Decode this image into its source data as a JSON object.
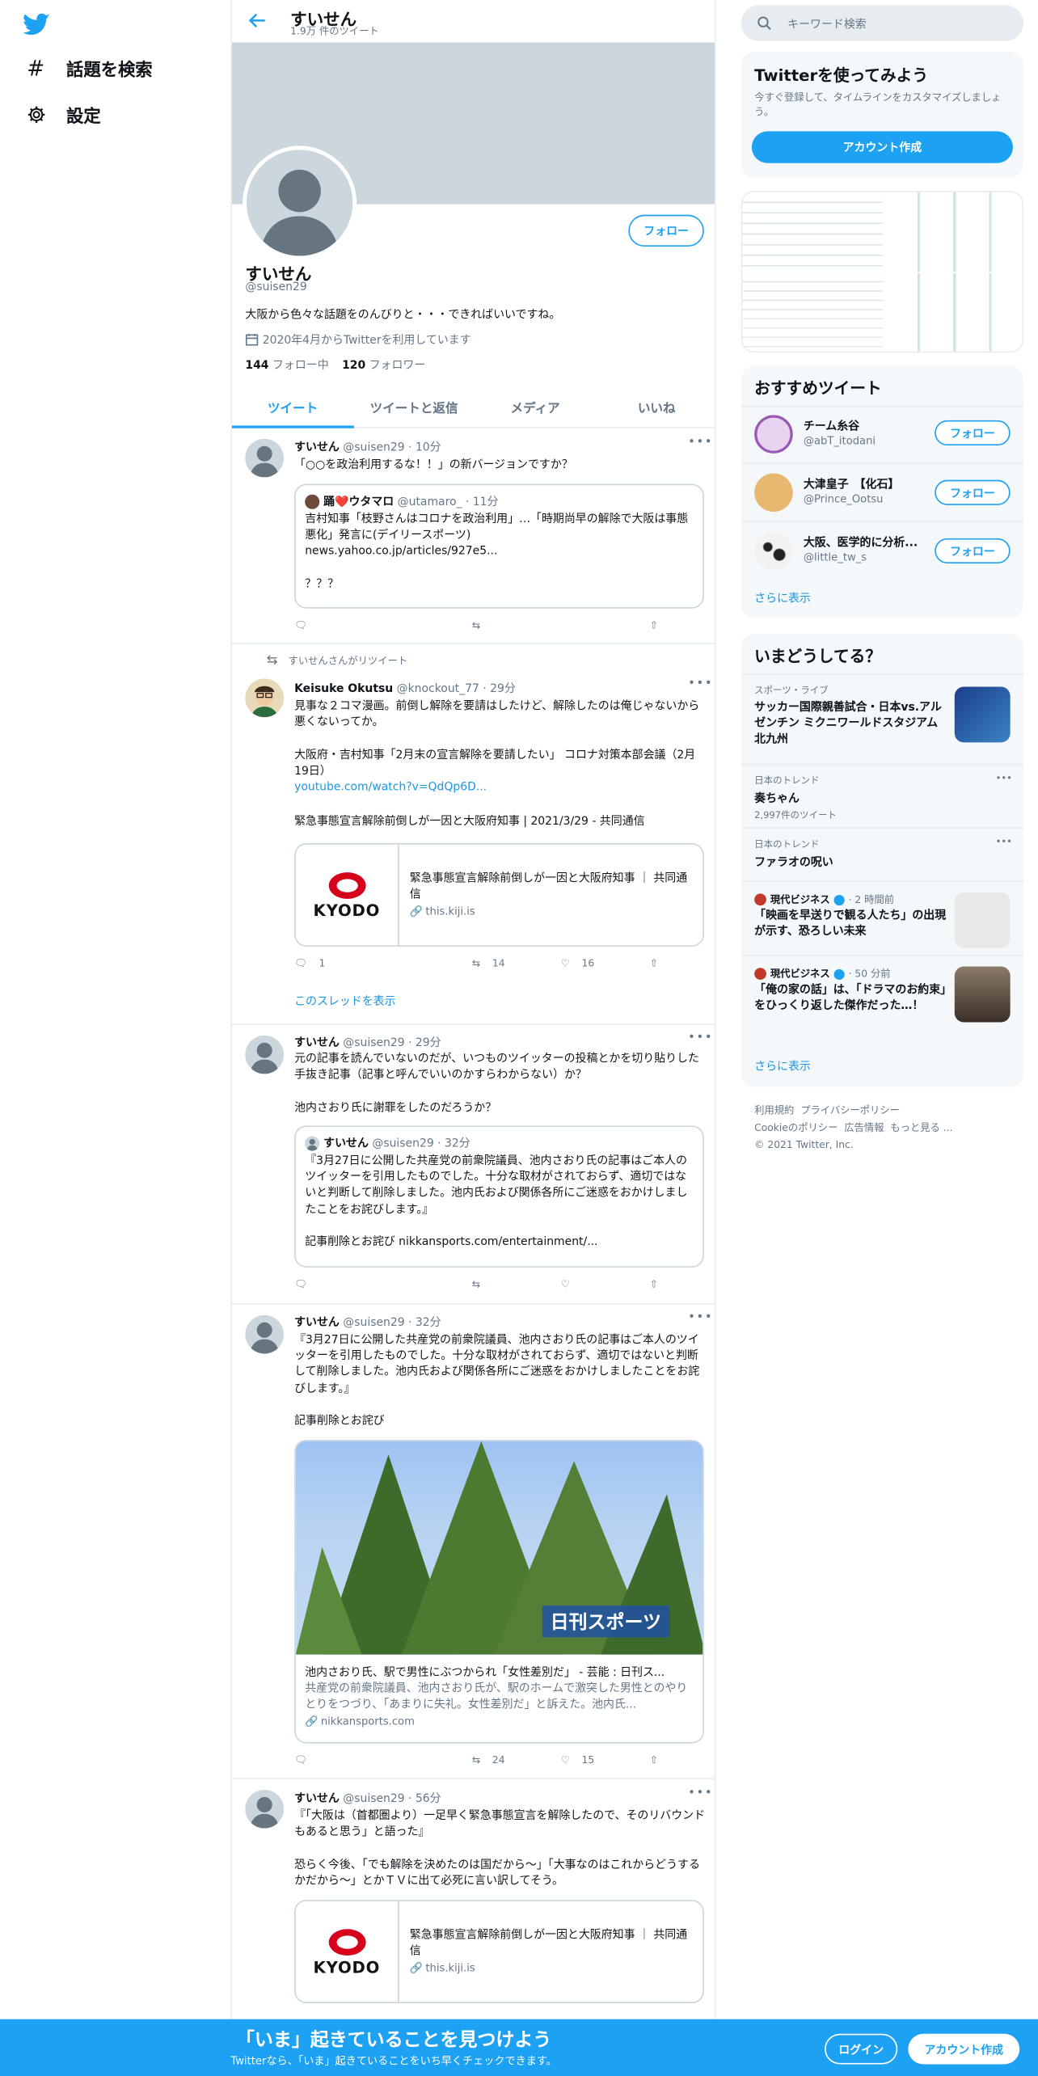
{
  "nav": {
    "explore_label": "話題を検索",
    "settings_label": "設定"
  },
  "header": {
    "title": "すいせん",
    "tweet_count": "1.9万 件のツイート"
  },
  "profile": {
    "follow_label": "フォロー",
    "name": "すいせん",
    "handle": "@suisen29",
    "bio": "大阪から色々な話題をのんびりと・・・できればいいですね。",
    "joined": "2020年4月からTwitterを利用しています",
    "following_count": "144",
    "following_label": "フォロー中",
    "followers_count": "120",
    "followers_label": "フォロワー"
  },
  "tabs": [
    "ツイート",
    "ツイートと返信",
    "メディア",
    "いいね"
  ],
  "tweets": {
    "t1": {
      "name": "すいせん",
      "meta": "@suisen29 · 10分",
      "text": "「○○を政治利用するな！！」の新バージョンですか？",
      "quote": {
        "name": "踊❤️ウタマロ",
        "meta": "@utamaro_ · 11分",
        "text": "吉村知事「枝野さんはコロナを政治利用」…「時期尚早の解除で大阪は事態悪化」発言に(デイリースポーツ)\nnews.yahoo.co.jp/articles/927e5...\n\n？？？"
      }
    },
    "t2": {
      "retweet_label": "すいせんさんがリツイート",
      "name": "Keisuke Okutsu",
      "meta": "@knockout_77 · 29分",
      "text1": "見事な２コマ漫画。前倒し解除を要請はしたけど、解除したのは俺じゃないから悪くないってか。\n\n大阪府・吉村知事「2月末の宣言解除を要請したい」 コロナ対策本部会議（2月19日）",
      "link": "youtube.com/watch?v=QdQp6D...",
      "text2": "緊急事態宣言解除前倒しが一因と大阪府知事 | 2021/3/29 - 共同通信",
      "card_title": "緊急事態宣言解除前倒しが一因と大阪府知事 ｜ 共同通信",
      "card_domain": "this.kiji.is",
      "kyodo": "KYODO",
      "replies": "1",
      "retweets": "14",
      "likes": "16",
      "thread_label": "このスレッドを表示"
    },
    "t3": {
      "name": "すいせん",
      "meta": "@suisen29 · 29分",
      "text": "元の記事を読んでいないのだが、いつものツイッターの投稿とかを切り貼りした手抜き記事（記事と呼んでいいのかすらわからない）か？\n\n池内さおり氏に謝罪をしたのだろうか？",
      "quote": {
        "name": "すいせん",
        "meta": "@suisen29 · 32分",
        "text": "『3月27日に公開した共産党の前衆院議員、池内さおり氏の記事はご本人のツイッターを引用したものでした。十分な取材がされておらず、適切ではないと判断して削除しました。池内氏および関係各所にご迷惑をおかけしましたことをお詫びします。』\n\n記事削除とお詫び nikkansports.com/entertainment/..."
      }
    },
    "t4": {
      "name": "すいせん",
      "meta": "@suisen29 · 32分",
      "text": "『3月27日に公開した共産党の前衆院議員、池内さおり氏の記事はご本人のツイッターを引用したものでした。十分な取材がされておらず、適切ではないと判断して削除しました。池内氏および関係各所にご迷惑をおかけしましたことをお詫びします。』\n\n記事削除とお詫び",
      "image_badge": "日刊スポーツ",
      "card_title": "池内さおり氏、駅で男性にぶつかられ「女性差別だ」 - 芸能 : 日刊ス...",
      "card_desc": "共産党の前衆院議員、池内さおり氏が、駅のホームで激突した男性とのやりとりをつづり、「あまりに失礼。女性差別だ」と訴えた。池内氏...",
      "card_domain": "nikkansports.com",
      "retweets": "24",
      "likes": "15"
    },
    "t5": {
      "name": "すいせん",
      "meta": "@suisen29 · 56分",
      "text": "『「大阪は（首都圏より）一足早く緊急事態宣言を解除したので、そのリバウンドもあると思う」と語った』\n\n恐らく今後、「でも解除を決めたのは国だから～」「大事なのはこれからどうするかだから～」とかＴＶに出て必死に言い訳してそう。",
      "card_title": "緊急事態宣言解除前倒しが一因と大阪府知事 ｜ 共同通信",
      "card_domain": "this.kiji.is",
      "kyodo": "KYODO"
    }
  },
  "sidebar": {
    "search_placeholder": "キーワード検索",
    "signup": {
      "title": "Twitterを使ってみよう",
      "desc": "今すぐ登録して、タイムラインをカスタマイズしましょう。",
      "button": "アカウント作成"
    },
    "recommend": {
      "title": "おすすめツイート",
      "users": [
        {
          "name": "チーム糸谷",
          "handle": "@abT_itodani"
        },
        {
          "name": "大津皇子　【化石】",
          "handle": "@Prince_Ootsu"
        },
        {
          "name": "大阪、医学的に分析...",
          "handle": "@little_tw_s"
        }
      ],
      "follow_label": "フォロー",
      "more": "さらに表示"
    },
    "trends": {
      "title": "いまどうしてる？",
      "items": [
        {
          "category": "スポーツ・ライブ",
          "text": "サッカー国際親善試合・日本vs.アルゼンチン ミクニワールドスタジアム北九州"
        },
        {
          "category": "日本のトレンド",
          "text": "奏ちゃん",
          "count": "2,997件のツイート"
        },
        {
          "category": "日本のトレンド",
          "text": "ファラオの呪い"
        },
        {
          "source": "現代ビジネス",
          "time": "· 2 時間前",
          "text": "「映画を早送りで観る人たち」の出現が示す、恐ろしい未来"
        },
        {
          "source": "現代ビジネス",
          "time": "· 50 分前",
          "text": "「俺の家の話」は、「ドラマのお約束」をひっくり返した傑作だった…！"
        }
      ],
      "more": "さらに表示"
    },
    "footer": {
      "terms": "利用規約",
      "privacy": "プライバシーポリシー",
      "cookie": "Cookieのポリシー",
      "ads": "広告情報",
      "more": "もっと見る ...",
      "copyright": "© 2021 Twitter, Inc."
    }
  },
  "bottom": {
    "title": "「いま」起きていることを見つけよう",
    "subtitle": "Twitterなら、「いま」起きていることをいち早くチェックできます。",
    "login": "ログイン",
    "signup": "アカウント作成"
  }
}
